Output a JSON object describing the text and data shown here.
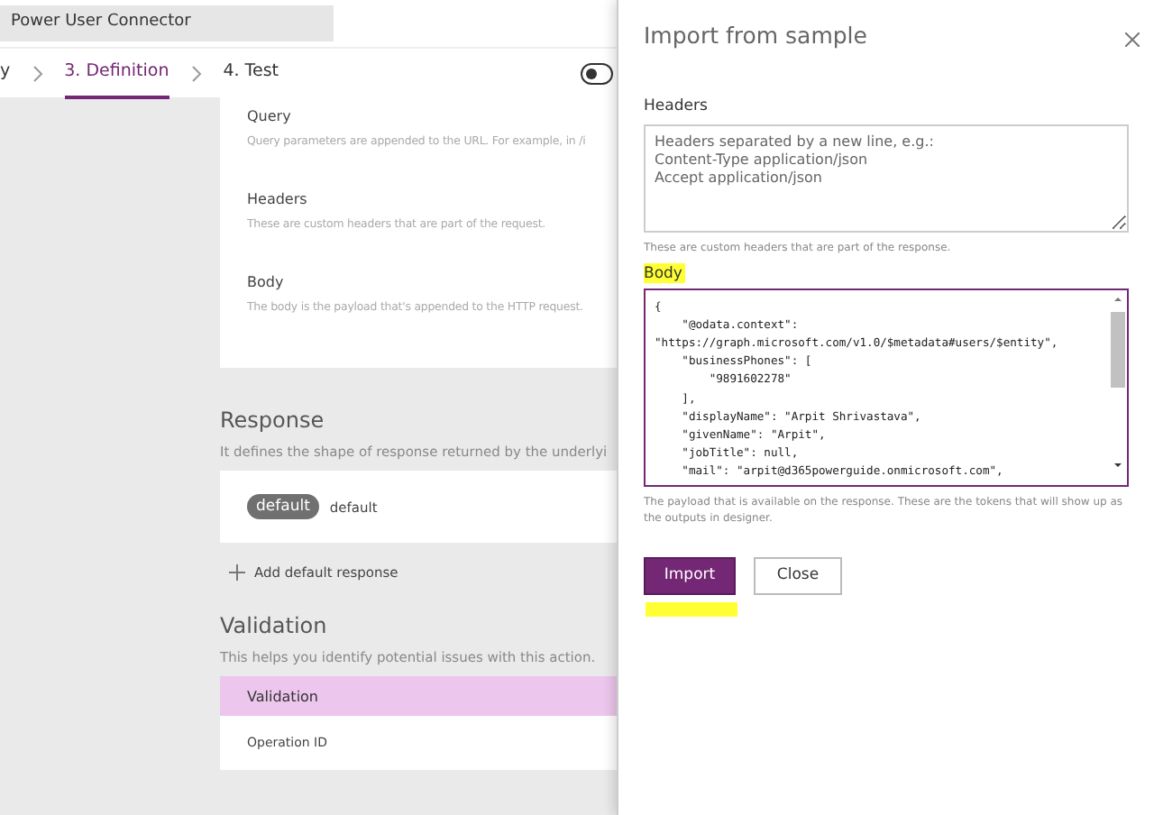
{
  "app_title": "Power User Connector",
  "steps": [
    {
      "label": "y",
      "selected": false
    },
    {
      "label": "3. Definition",
      "selected": true
    },
    {
      "label": "4. Test",
      "selected": false
    }
  ],
  "toggle": {
    "on": false
  },
  "request": [
    {
      "title": "Query",
      "description": "Query parameters are appended to the URL. For example, in /i"
    },
    {
      "title": "Headers",
      "description": "These are custom headers that are part of the request."
    },
    {
      "title": "Body",
      "description": "The body is the payload that's appended to the HTTP request."
    }
  ],
  "response": {
    "title": "Response",
    "description": "It defines the shape of response returned by the underlyi",
    "badge": "default",
    "name": "default",
    "add_label": "Add default response"
  },
  "validation": {
    "title": "Validation",
    "description": "This helps you identify potential issues with this action.",
    "header": "Validation",
    "row": "Operation ID"
  },
  "panel": {
    "title": "Import from sample",
    "headers_label": "Headers",
    "headers_placeholder": "Headers separated by a new line, e.g.:\nContent-Type application/json\nAccept application/json",
    "headers_hint": "These are custom headers that are part of the response.",
    "body_label": "Body",
    "body_label_highlighted": true,
    "body_lines": [
      "{",
      "    \"@odata.context\":",
      "\"https://graph.microsoft.com/v1.0/$metadata#users/$entity\",",
      "    \"businessPhones\": [",
      "        \"9891602278\"",
      "    ],",
      "    \"displayName\": \"Arpit Shrivastava\",",
      "    \"givenName\": \"Arpit\",",
      "    \"jobTitle\": null,",
      "    \"mail\": \"arpit@d365powerguide.onmicrosoft.com\","
    ],
    "body_hint": "The payload that is available on the response. These are the tokens that will show up as the outputs in designer.",
    "import_label": "Import",
    "import_underlined": true,
    "close_label": "Close"
  }
}
